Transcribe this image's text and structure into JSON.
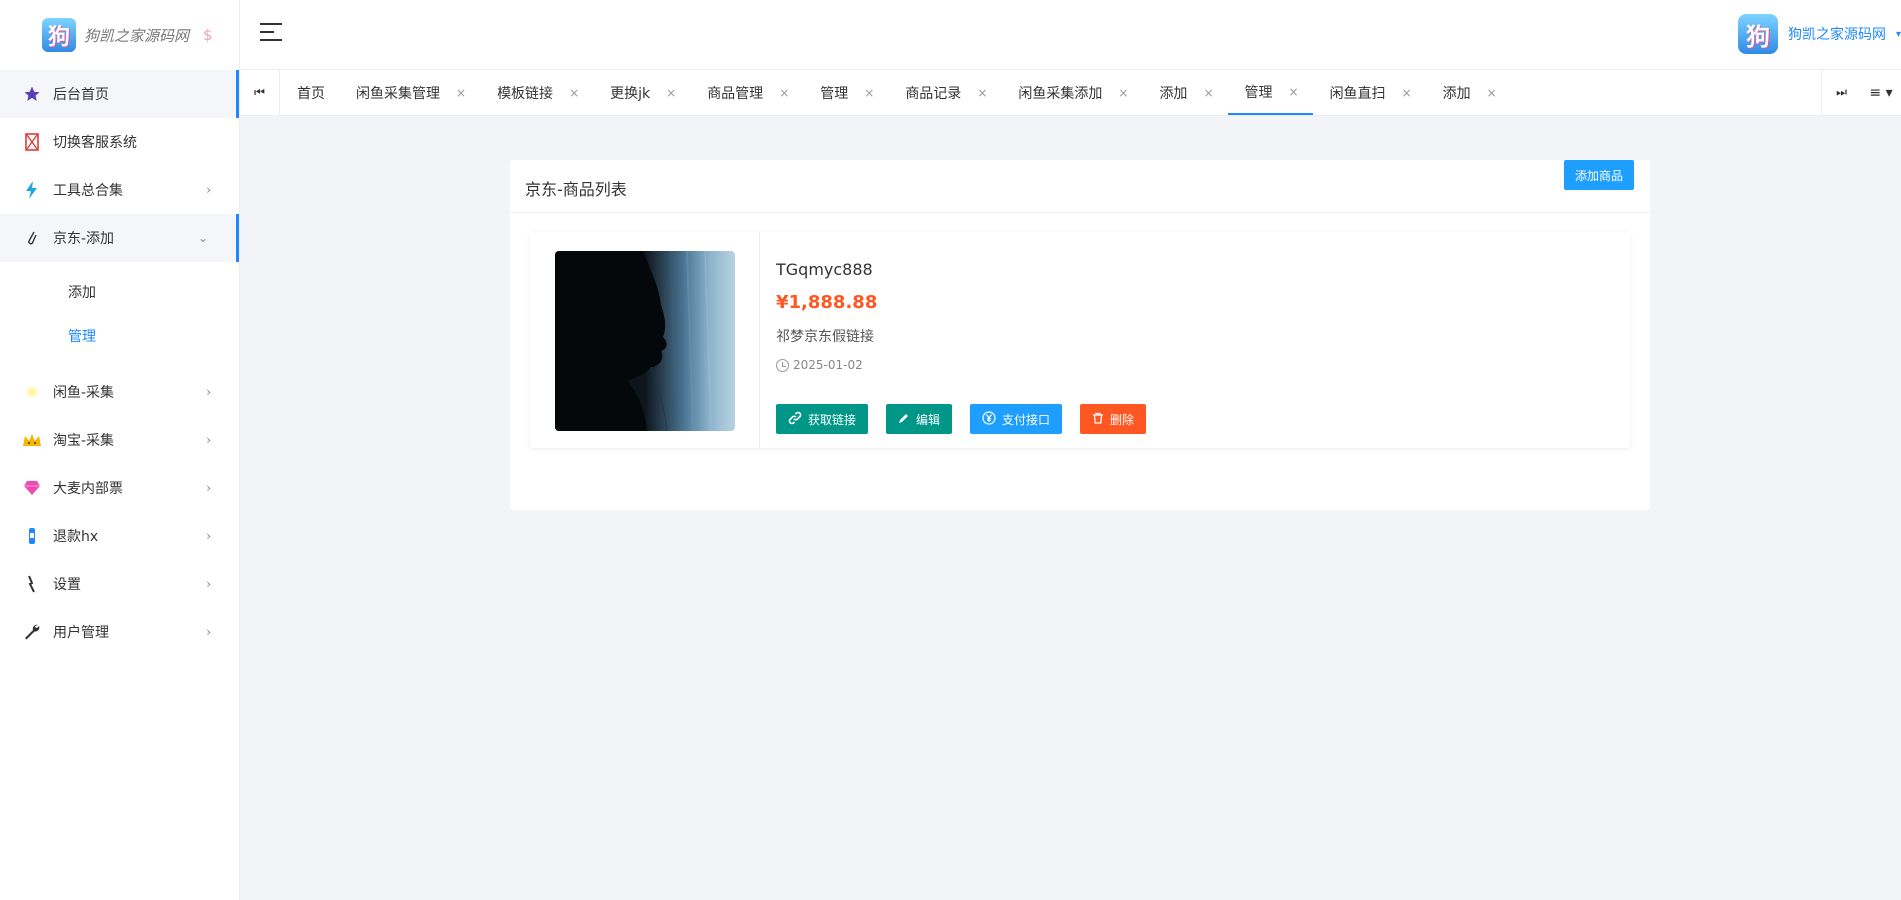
{
  "colors": {
    "accent": "#1e88ff",
    "primary_button": "#1e9fff",
    "green_button": "#009688",
    "danger_button": "#ff5722",
    "price": "#ff5722"
  },
  "brand": {
    "logo_glyph": "狗",
    "name": "狗凯之家源码网",
    "dollar": "$"
  },
  "sidebar": {
    "items": [
      {
        "label": "后台首页",
        "icon": "star-icon"
      },
      {
        "label": "切换客服系统",
        "icon": "flag-icon"
      },
      {
        "label": "工具总合集",
        "icon": "lightning-icon",
        "chevron": "›"
      },
      {
        "label": "京东-添加",
        "icon": "paperclip-icon",
        "chevron": "⌄"
      },
      {
        "label": "闲鱼-采集",
        "icon": "fish-icon",
        "chevron": "›"
      },
      {
        "label": "淘宝-采集",
        "icon": "crown-icon",
        "chevron": "›"
      },
      {
        "label": "大麦内部票",
        "icon": "gem-icon",
        "chevron": "›"
      },
      {
        "label": "退款hx",
        "icon": "bottle-icon",
        "chevron": "›"
      },
      {
        "label": "设置",
        "icon": "tool-icon",
        "chevron": "›"
      },
      {
        "label": "用户管理",
        "icon": "wrench-icon",
        "chevron": "›"
      }
    ],
    "submenu": [
      {
        "label": "添加"
      },
      {
        "label": "管理"
      }
    ]
  },
  "header": {
    "avatar_glyph": "狗",
    "user_name": "狗凯之家源码网",
    "caret": "▾"
  },
  "tabbar": {
    "prev_glyph": "⏮",
    "next_glyph": "⏭",
    "menu_glyph": "≡ ▾",
    "close_glyph": "×",
    "tabs": [
      {
        "label": "首页",
        "closable": false
      },
      {
        "label": "闲鱼采集管理",
        "closable": true
      },
      {
        "label": "模板链接",
        "closable": true
      },
      {
        "label": "更换jk",
        "closable": true
      },
      {
        "label": "商品管理",
        "closable": true
      },
      {
        "label": "管理",
        "closable": true
      },
      {
        "label": "商品记录",
        "closable": true
      },
      {
        "label": "闲鱼采集添加",
        "closable": true
      },
      {
        "label": "添加",
        "closable": true
      },
      {
        "label": "管理",
        "closable": true,
        "active": true
      },
      {
        "label": "闲鱼直扫",
        "closable": true
      },
      {
        "label": "添加",
        "closable": true
      }
    ]
  },
  "main": {
    "card_title": "京东-商品列表",
    "add_button": "添加商品",
    "product": {
      "name": "TGqmyc888",
      "price": "¥1,888.88",
      "description": "祁梦京东假链接",
      "date": "2025-01-02",
      "buttons": {
        "get_link": "获取链接",
        "edit": "编辑",
        "pay": "支付接口",
        "delete": "删除"
      }
    }
  }
}
